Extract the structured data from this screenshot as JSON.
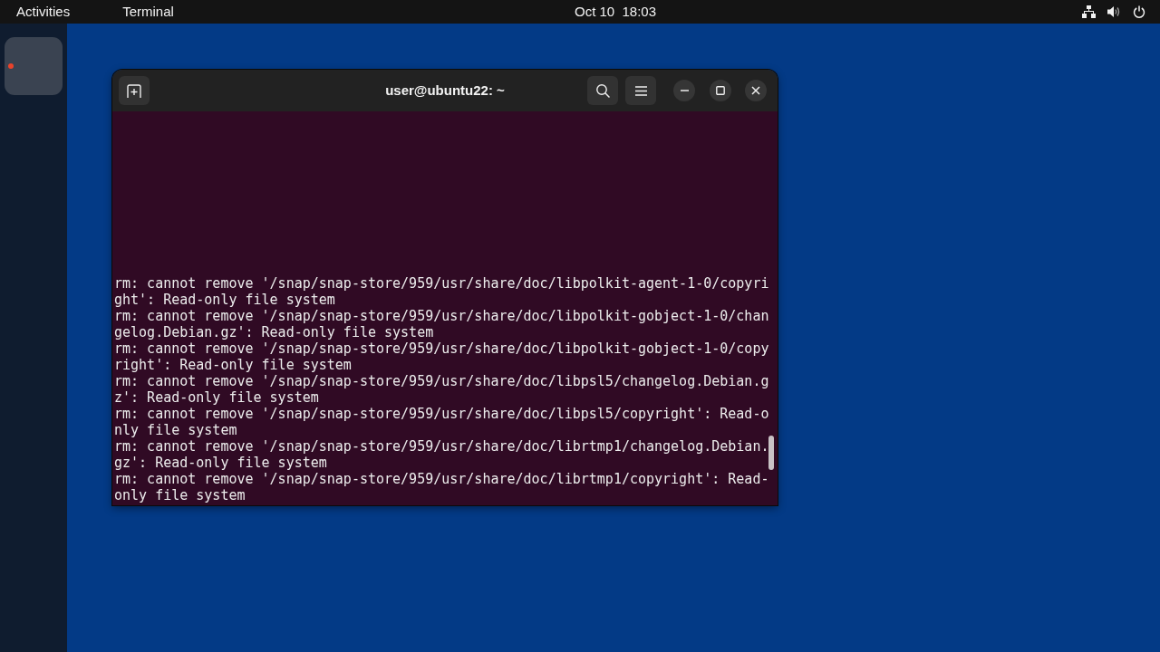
{
  "top_bar": {
    "activities": "Activities",
    "app_menu": "Terminal",
    "clock": "Oct 10  18:03"
  },
  "dock": {
    "apps": [
      {
        "selected": true,
        "running": true
      }
    ]
  },
  "window": {
    "title": "user@ubuntu22: ~",
    "lines": [
      "rm: cannot remove '/snap/snap-store/959/usr/share/doc/libpolkit-agent-1-0/copyri",
      "ght': Read-only file system",
      "rm: cannot remove '/snap/snap-store/959/usr/share/doc/libpolkit-gobject-1-0/chan",
      "gelog.Debian.gz': Read-only file system",
      "rm: cannot remove '/snap/snap-store/959/usr/share/doc/libpolkit-gobject-1-0/copy",
      "right': Read-only file system",
      "rm: cannot remove '/snap/snap-store/959/usr/share/doc/libpsl5/changelog.Debian.g",
      "z': Read-only file system",
      "rm: cannot remove '/snap/snap-store/959/usr/share/doc/libpsl5/copyright': Read-o",
      "nly file system",
      "rm: cannot remove '/snap/snap-store/959/usr/share/doc/librtmp1/changelog.Debian.",
      "gz': Read-only file system",
      "rm: cannot remove '/snap/snap-store/959/usr/share/doc/librtmp1/copyright': Read-",
      "only file system"
    ]
  }
}
